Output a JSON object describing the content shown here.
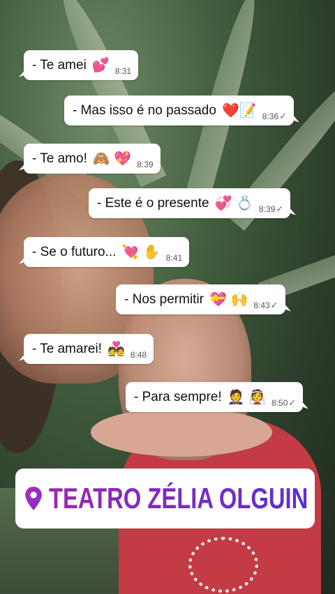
{
  "messages": [
    {
      "text": "- Te amei",
      "emoji": "💕",
      "time": "8:31",
      "dir": "in"
    },
    {
      "text": "- Mas isso é no passado",
      "emoji": "❤️📝",
      "time": "8:36",
      "dir": "out",
      "tick": "✓"
    },
    {
      "text": "-  Te amo!",
      "emoji": "🙈 💖",
      "time": "8:39",
      "dir": "in"
    },
    {
      "text": "- Este é o presente",
      "emoji": "💞 💍",
      "time": "8:39",
      "dir": "out",
      "tick": "✓"
    },
    {
      "text": "- Se o futuro...",
      "emoji": "💘 ✋",
      "time": "8:41",
      "dir": "in"
    },
    {
      "text": "- Nos permitir",
      "emoji": "💝 🙌",
      "time": "8:43",
      "dir": "out",
      "tick": "✓"
    },
    {
      "text": "- Te amarei!",
      "emoji": "💑",
      "time": "8:48",
      "dir": "in"
    },
    {
      "text": "- Para sempre!",
      "emoji": "🤵 👰",
      "time": "8:50",
      "dir": "out",
      "tick": "✓"
    }
  ],
  "location_sticker": {
    "text": "TEATRO ZÉLIA OLGUIN",
    "icon": "location-pin-icon",
    "color_start": "#9b27b0",
    "color_end": "#5b2fd3"
  }
}
